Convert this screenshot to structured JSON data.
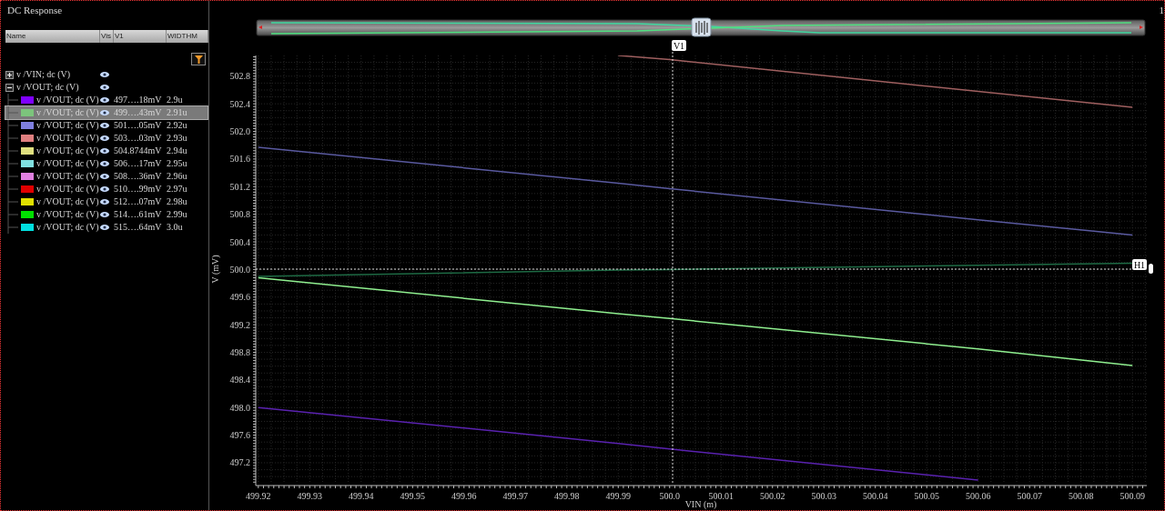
{
  "window": {
    "title": "DC Response",
    "corner_label": "1"
  },
  "legend": {
    "columns": [
      "Name",
      "Vis",
      "V1",
      "WIDTHM"
    ],
    "tree": [
      {
        "name": "v /VIN; dc (V)",
        "expanded": false,
        "selected": false
      },
      {
        "name": "v /VOUT; dc (V)",
        "expanded": true,
        "selected": false,
        "children": [
          {
            "name": "v /VOUT; dc (V)",
            "color": "#7f00ff",
            "v1": "497….18mV",
            "widthm": "2.9u",
            "selected": false
          },
          {
            "name": "v /VOUT; dc (V)",
            "color": "#7cc47c",
            "v1": "499….43mV",
            "widthm": "2.91u",
            "selected": true
          },
          {
            "name": "v /VOUT; dc (V)",
            "color": "#8080e0",
            "v1": "501….05mV",
            "widthm": "2.92u",
            "selected": false
          },
          {
            "name": "v /VOUT; dc (V)",
            "color": "#e08080",
            "v1": "503….03mV",
            "widthm": "2.93u",
            "selected": false
          },
          {
            "name": "v /VOUT; dc (V)",
            "color": "#e0e080",
            "v1": "504.8744mV",
            "widthm": "2.94u",
            "selected": false
          },
          {
            "name": "v /VOUT; dc (V)",
            "color": "#80e0e0",
            "v1": "506….17mV",
            "widthm": "2.95u",
            "selected": false
          },
          {
            "name": "v /VOUT; dc (V)",
            "color": "#e080e0",
            "v1": "508….36mV",
            "widthm": "2.96u",
            "selected": false
          },
          {
            "name": "v /VOUT; dc (V)",
            "color": "#e00000",
            "v1": "510….99mV",
            "widthm": "2.97u",
            "selected": false
          },
          {
            "name": "v /VOUT; dc (V)",
            "color": "#e0e000",
            "v1": "512….07mV",
            "widthm": "2.98u",
            "selected": false
          },
          {
            "name": "v /VOUT; dc (V)",
            "color": "#00e000",
            "v1": "514….61mV",
            "widthm": "2.99u",
            "selected": false
          },
          {
            "name": "v /VOUT; dc (V)",
            "color": "#00e0e0",
            "v1": "515….64mV",
            "widthm": "3.0u",
            "selected": false
          }
        ]
      }
    ]
  },
  "chart": {
    "cursors": [
      {
        "kind": "vertical",
        "label": "V1"
      },
      {
        "kind": "horizontal",
        "label": "H1"
      }
    ],
    "chart_data": {
      "type": "line",
      "grid": true,
      "xlabel": "VIN (m)",
      "ylabel": "V (mV)",
      "x": [
        499.92,
        499.99,
        500.0,
        500.06,
        500.09
      ],
      "series": [
        {
          "color": "#5a22b0",
          "values": [
            498.0,
            497.48,
            497.4,
            496.95,
            null
          ]
        },
        {
          "color": "#90f090",
          "values": [
            499.88,
            499.36,
            499.29,
            498.85,
            498.61
          ]
        },
        {
          "color": "#5a5aa0",
          "values": [
            501.77,
            501.25,
            501.17,
            500.72,
            500.5
          ]
        },
        {
          "color": "#a06060",
          "values": [
            null,
            503.1,
            503.04,
            502.58,
            502.35
          ]
        },
        {
          "color": "#1e6a44",
          "values": [
            499.9,
            499.99,
            500.0,
            500.06,
            500.09
          ]
        }
      ],
      "xlim": [
        499.9195,
        500.0928
      ],
      "ylim": [
        496.91,
        503.1
      ],
      "xticks": [
        499.92,
        499.93,
        499.94,
        499.95,
        499.96,
        499.97,
        499.98,
        499.99,
        {
          "value": 500.0,
          "label": "500.0"
        },
        500.01,
        500.02,
        500.03,
        500.04,
        500.05,
        500.06,
        500.07,
        500.08,
        500.09
      ],
      "yticks": [
        497.2,
        497.6,
        {
          "value": 498.0,
          "label": "498.0"
        },
        498.4,
        498.8,
        499.2,
        499.6,
        {
          "value": 500.0,
          "label": "500.0"
        },
        500.4,
        500.8,
        501.2,
        501.6,
        {
          "value": 502.0,
          "label": "502.0"
        },
        502.4,
        502.8
      ]
    }
  }
}
